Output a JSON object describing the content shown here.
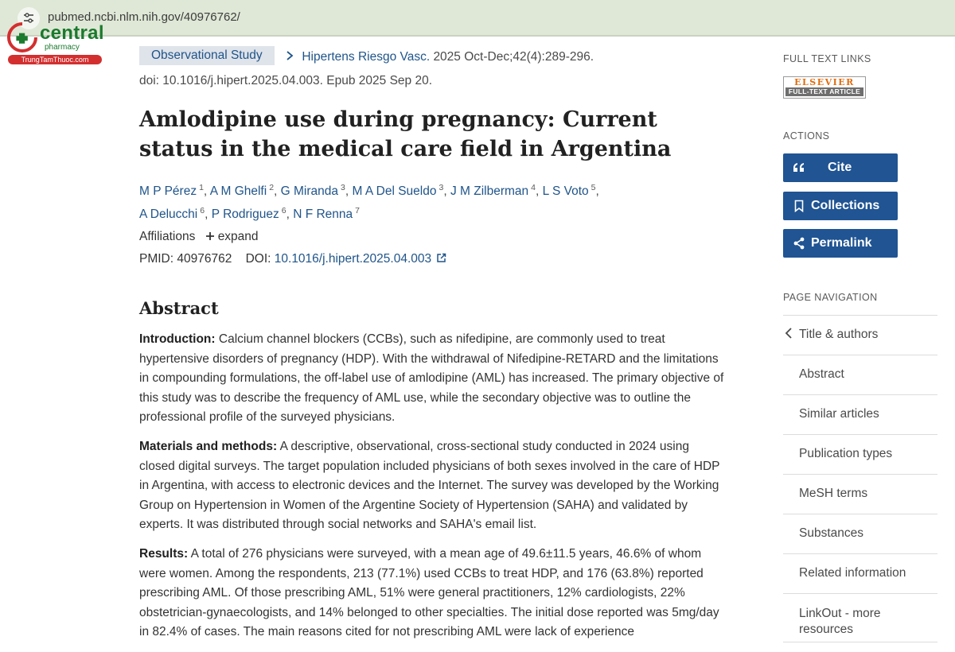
{
  "browser": {
    "url": "pubmed.ncbi.nlm.nih.gov/40976762/"
  },
  "watermark": {
    "brand": "central",
    "sub": "pharmacy",
    "tag": "TrungTamThuoc.com"
  },
  "article": {
    "publication_type": "Observational Study",
    "journal": "Hipertens Riesgo Vasc.",
    "citation": "2025 Oct-Dec;42(4):289-296.",
    "doi_line": "doi: 10.1016/j.hipert.2025.04.003. Epub 2025 Sep 20.",
    "title": "Amlodipine use during pregnancy: Current status in the medical care field in Argentina",
    "authors": [
      {
        "name": "M P Pérez",
        "sup": "1"
      },
      {
        "name": "A M Ghelfi",
        "sup": "2"
      },
      {
        "name": "G Miranda",
        "sup": "3"
      },
      {
        "name": "M A Del Sueldo",
        "sup": "3"
      },
      {
        "name": "J M Zilberman",
        "sup": "4"
      },
      {
        "name": "L S Voto",
        "sup": "5"
      },
      {
        "name": "A Delucchi",
        "sup": "6"
      },
      {
        "name": "P Rodriguez",
        "sup": "6"
      },
      {
        "name": "N F Renna",
        "sup": "7"
      }
    ],
    "affiliations_label": "Affiliations",
    "expand_label": "expand",
    "pmid_label": "PMID:",
    "pmid": "40976762",
    "doi_label": "DOI:",
    "doi": "10.1016/j.hipert.2025.04.003"
  },
  "abstract": {
    "heading": "Abstract",
    "sections": [
      {
        "label": "Introduction:",
        "text": "Calcium channel blockers (CCBs), such as nifedipine, are commonly used to treat hypertensive disorders of pregnancy (HDP). With the withdrawal of Nifedipine-RETARD and the limitations in compounding formulations, the off-label use of amlodipine (AML) has increased. The primary objective of this study was to describe the frequency of AML use, while the secondary objective was to outline the professional profile of the surveyed physicians."
      },
      {
        "label": "Materials and methods:",
        "text": "A descriptive, observational, cross-sectional study conducted in 2024 using closed digital surveys. The target population included physicians of both sexes involved in the care of HDP in Argentina, with access to electronic devices and the Internet. The survey was developed by the Working Group on Hypertension in Women of the Argentine Society of Hypertension (SAHA) and validated by experts. It was distributed through social networks and SAHA's email list."
      },
      {
        "label": "Results:",
        "text": "A total of 276 physicians were surveyed, with a mean age of 49.6±11.5 years, 46.6% of whom were women. Among the respondents, 213 (77.1%) used CCBs to treat HDP, and 176 (63.8%) reported prescribing AML. Of those prescribing AML, 51% were general practitioners, 12% cardiologists, 22% obstetrician-gynaecologists, and 14% belonged to other specialties. The initial dose reported was 5mg/day in 82.4% of cases. The main reasons cited for not prescribing AML were lack of experience"
      }
    ]
  },
  "sidebar": {
    "full_text_links_label": "FULL TEXT LINKS",
    "elsevier_top": "ELSEVIER",
    "elsevier_bottom": "FULL-TEXT ARTICLE",
    "actions_label": "ACTIONS",
    "cite_label": "Cite",
    "collections_label": "Collections",
    "permalink_label": "Permalink",
    "page_nav_label": "PAGE NAVIGATION",
    "nav_items": [
      "Title & authors",
      "Abstract",
      "Similar articles",
      "Publication types",
      "MeSH terms",
      "Substances",
      "Related information",
      "LinkOut - more resources"
    ]
  },
  "colors": {
    "link": "#20558a",
    "button": "#205493",
    "pubtype_bg": "#dfe3ea",
    "browser_bar": "#dfe8d6"
  }
}
